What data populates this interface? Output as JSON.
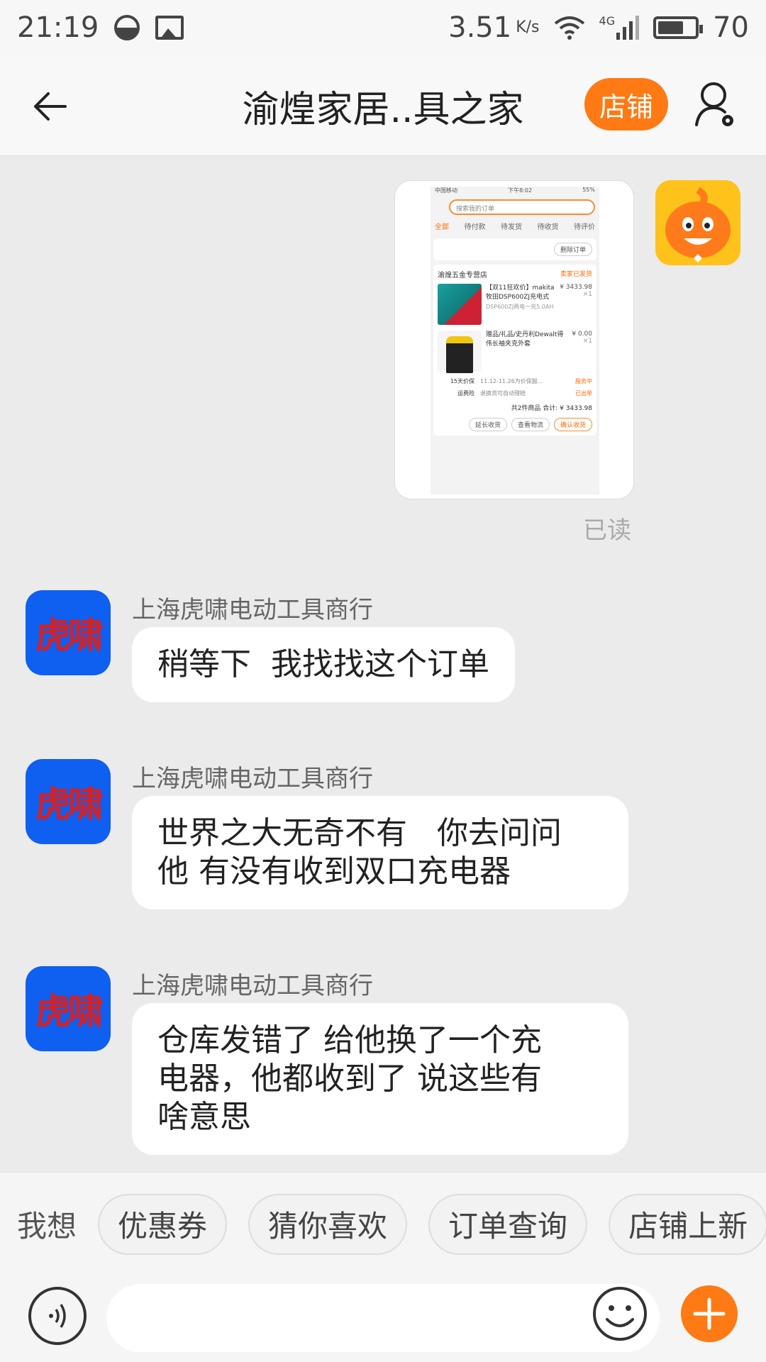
{
  "status_bar": {
    "time": "21:19",
    "speed": "3.51",
    "speed_unit": "K/s",
    "network": "4G",
    "battery": "70"
  },
  "header": {
    "title": "渝煌家居..具之家",
    "store_button": "店铺"
  },
  "shared_screenshot": {
    "status": {
      "carrier": "中国移动",
      "time": "下午8:02",
      "battery": "55%"
    },
    "search_placeholder": "搜索我的订单",
    "tabs": [
      "全部",
      "待付款",
      "待发货",
      "待收货",
      "待评价"
    ],
    "delete_order": "删除订单",
    "shop_name": "渝煌五金专营店",
    "shop_status": "卖家已发货",
    "items": [
      {
        "desc": "【双11狂欢价】makita 牧田DSP600ZJ充电式",
        "sub": "DSP600ZJ两电一充5.0AH",
        "price": "¥ 3433.98",
        "qty": "×1"
      },
      {
        "desc": "赠品/礼品/史丹利Dewalt得伟长袖夹克外套",
        "sub": "",
        "price": "¥ 0.00",
        "qty": "×1"
      }
    ],
    "rows": [
      {
        "label": "15天价保",
        "text": "11.12-11.26为价保服...",
        "status": "服务中"
      },
      {
        "label": "运费险",
        "text": "退换货可自动理赔",
        "status": "已出单"
      }
    ],
    "total": "共2件商品 合计: ¥ 3433.98",
    "buttons": [
      "延长收货",
      "查看物流",
      "确认收货"
    ]
  },
  "read_status": "已读",
  "messages": [
    {
      "sender": "上海虎啸电动工具商行",
      "avatar_text": "虎啸",
      "text": "稍等下  我找找这个订单"
    },
    {
      "sender": "上海虎啸电动工具商行",
      "avatar_text": "虎啸",
      "text": "世界之大无奇不有   你去问问\n他 有没有收到双口充电器"
    },
    {
      "sender": "上海虎啸电动工具商行",
      "avatar_text": "虎啸",
      "text": "仓库发错了 给他换了一个充\n电器，他都收到了 说这些有\n啥意思"
    }
  ],
  "quick_bar": {
    "label": "我想",
    "chips": [
      "优惠券",
      "猜你喜欢",
      "订单查询",
      "店铺上新"
    ]
  },
  "input": {
    "placeholder": ""
  },
  "colors": {
    "accent": "#ff7a14",
    "avatar_bg": "#0f5ff0",
    "avatar_text": "#d82020"
  }
}
